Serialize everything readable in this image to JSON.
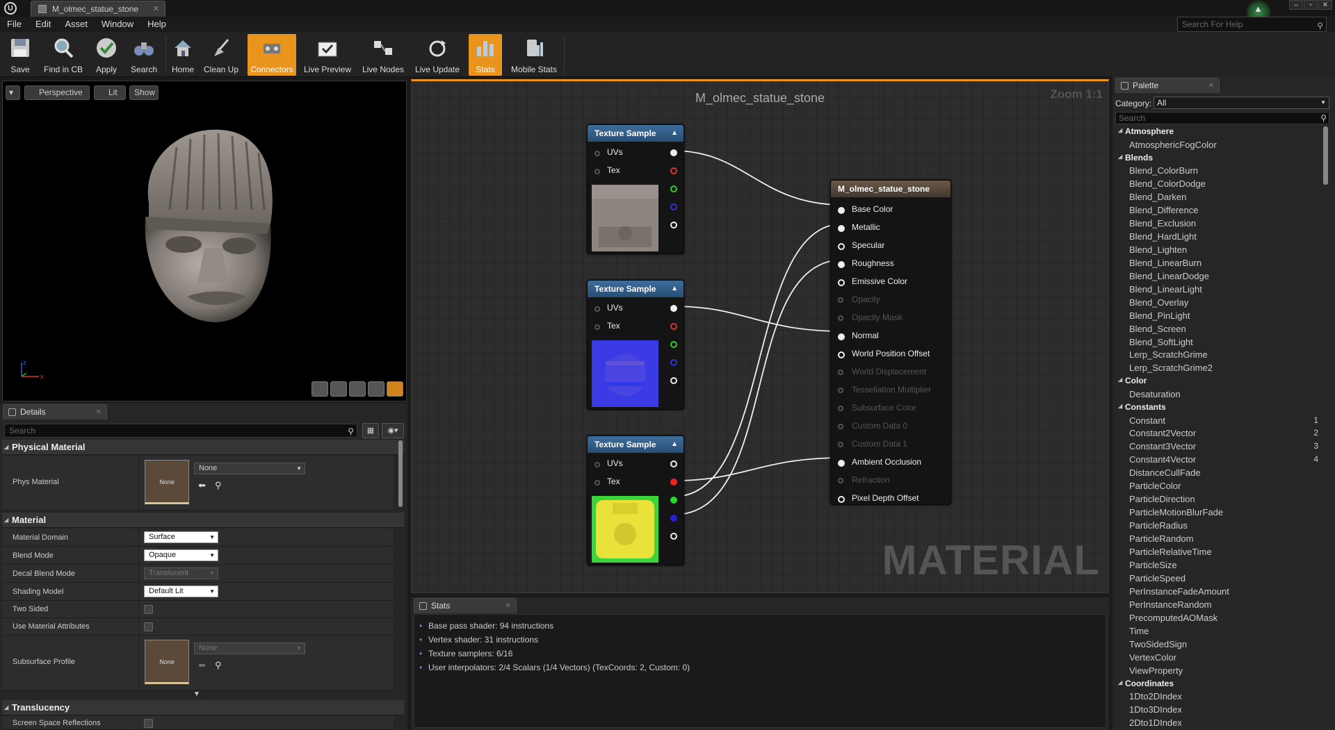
{
  "window": {
    "tab_title": "M_olmec_statue_stone",
    "help_placeholder": "Search For Help"
  },
  "menu": [
    "File",
    "Edit",
    "Asset",
    "Window",
    "Help"
  ],
  "toolbar": {
    "save": "Save",
    "find_in_cb": "Find in CB",
    "apply": "Apply",
    "search": "Search",
    "home": "Home",
    "clean_up": "Clean Up",
    "connectors": "Connectors",
    "live_preview": "Live Preview",
    "live_nodes": "Live Nodes",
    "live_update": "Live Update",
    "stats": "Stats",
    "mobile_stats": "Mobile Stats"
  },
  "viewport": {
    "perspective": "Perspective",
    "lit": "Lit",
    "show": "Show",
    "axis_x": "x",
    "axis_z": "z"
  },
  "details": {
    "tab": "Details",
    "search_placeholder": "Search",
    "physical_material": {
      "title": "Physical Material",
      "phys_material_label": "Phys Material",
      "thumb": "None",
      "value": "None"
    },
    "material": {
      "title": "Material",
      "rows": [
        {
          "label": "Material Domain",
          "value": "Surface"
        },
        {
          "label": "Blend Mode",
          "value": "Opaque"
        },
        {
          "label": "Decal Blend Mode",
          "value": "Translucent"
        },
        {
          "label": "Shading Model",
          "value": "Default Lit"
        }
      ],
      "two_sided": "Two Sided",
      "use_material_attributes": "Use Material Attributes",
      "subsurface_profile": "Subsurface Profile",
      "subsurface_thumb": "None",
      "subsurface_value": "None"
    },
    "translucency": {
      "title": "Translucency",
      "ssr": "Screen Space Reflections"
    }
  },
  "graph": {
    "title": "M_olmec_statue_stone",
    "zoom": "Zoom 1:1",
    "watermark": "MATERIAL",
    "texture_nodes": [
      {
        "title": "Texture Sample",
        "uvs": "UVs",
        "tex": "Tex"
      },
      {
        "title": "Texture Sample",
        "uvs": "UVs",
        "tex": "Tex"
      },
      {
        "title": "Texture Sample",
        "uvs": "UVs",
        "tex": "Tex"
      }
    ],
    "material_node": {
      "title": "M_olmec_statue_stone",
      "pins": [
        "Base Color",
        "Metallic",
        "Specular",
        "Roughness",
        "Emissive Color",
        "Opacity",
        "Opacity Mask",
        "Normal",
        "World Position Offset",
        "World Displacement",
        "Tessellation Multiplier",
        "Subsurface Color",
        "Custom Data 0",
        "Custom Data 1",
        "Ambient Occlusion",
        "Refraction",
        "Pixel Depth Offset"
      ],
      "disabled": [
        false,
        false,
        false,
        false,
        false,
        true,
        true,
        false,
        false,
        true,
        true,
        true,
        true,
        true,
        false,
        true,
        false
      ]
    }
  },
  "stats": {
    "tab": "Stats",
    "lines": [
      "Base pass shader: 94 instructions",
      "Vertex shader: 31 instructions",
      "Texture samplers: 6/16",
      "User interpolators: 2/4 Scalars (1/4 Vectors) (TexCoords: 2, Custom: 0)"
    ]
  },
  "palette": {
    "tab": "Palette",
    "category_label": "Category:",
    "category_value": "All",
    "search_placeholder": "Search",
    "groups": [
      {
        "name": "Atmosphere",
        "items": [
          "AtmosphericFogColor"
        ]
      },
      {
        "name": "Blends",
        "items": [
          "Blend_ColorBurn",
          "Blend_ColorDodge",
          "Blend_Darken",
          "Blend_Difference",
          "Blend_Exclusion",
          "Blend_HardLight",
          "Blend_Lighten",
          "Blend_LinearBurn",
          "Blend_LinearDodge",
          "Blend_LinearLight",
          "Blend_Overlay",
          "Blend_PinLight",
          "Blend_Screen",
          "Blend_SoftLight",
          "Lerp_ScratchGrime",
          "Lerp_ScratchGrime2"
        ]
      },
      {
        "name": "Color",
        "items": [
          "Desaturation"
        ]
      },
      {
        "name": "Constants",
        "items": [
          "Constant",
          "Constant2Vector",
          "Constant3Vector",
          "Constant4Vector",
          "DistanceCullFade",
          "ParticleColor",
          "ParticleDirection",
          "ParticleMotionBlurFade",
          "ParticleRadius",
          "ParticleRandom",
          "ParticleRelativeTime",
          "ParticleSize",
          "ParticleSpeed",
          "PerInstanceFadeAmount",
          "PerInstanceRandom",
          "PrecomputedAOMask",
          "Time",
          "TwoSidedSign",
          "VertexColor",
          "ViewProperty"
        ],
        "hotkeys": [
          "1",
          "2",
          "3",
          "4"
        ]
      },
      {
        "name": "Coordinates",
        "items": [
          "1Dto2DIndex",
          "1Dto3DIndex",
          "2Dto1DIndex"
        ]
      }
    ]
  },
  "colors": {
    "accent": "#e8941d",
    "node_header": "#3e6e9c",
    "material_header": "#6a5a4a"
  }
}
